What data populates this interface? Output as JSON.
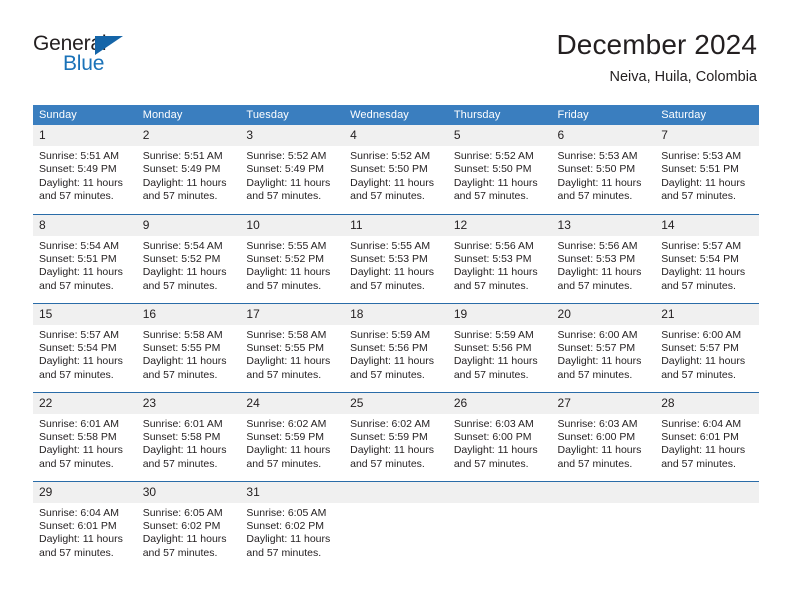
{
  "brand": {
    "name_top": "General",
    "name_bottom": "Blue",
    "accent_color": "#1a72b8",
    "triangle_color": "#1565a8"
  },
  "header": {
    "title": "December 2024",
    "subtitle": "Neiva, Huila, Colombia"
  },
  "theme": {
    "header_bg": "#3a7ebf",
    "daynum_bg": "#f0f0f0",
    "row_divider": "#2a6ca8",
    "text": "#231f20"
  },
  "weekday_headers": [
    "Sunday",
    "Monday",
    "Tuesday",
    "Wednesday",
    "Thursday",
    "Friday",
    "Saturday"
  ],
  "labels": {
    "sunrise_prefix": "Sunrise:",
    "sunset_prefix": "Sunset:",
    "daylight_prefix": "Daylight:"
  },
  "weeks": [
    [
      {
        "day": "1",
        "sunrise": "Sunrise: 5:51 AM",
        "sunset": "Sunset: 5:49 PM",
        "daylight": "Daylight: 11 hours and 57 minutes."
      },
      {
        "day": "2",
        "sunrise": "Sunrise: 5:51 AM",
        "sunset": "Sunset: 5:49 PM",
        "daylight": "Daylight: 11 hours and 57 minutes."
      },
      {
        "day": "3",
        "sunrise": "Sunrise: 5:52 AM",
        "sunset": "Sunset: 5:49 PM",
        "daylight": "Daylight: 11 hours and 57 minutes."
      },
      {
        "day": "4",
        "sunrise": "Sunrise: 5:52 AM",
        "sunset": "Sunset: 5:50 PM",
        "daylight": "Daylight: 11 hours and 57 minutes."
      },
      {
        "day": "5",
        "sunrise": "Sunrise: 5:52 AM",
        "sunset": "Sunset: 5:50 PM",
        "daylight": "Daylight: 11 hours and 57 minutes."
      },
      {
        "day": "6",
        "sunrise": "Sunrise: 5:53 AM",
        "sunset": "Sunset: 5:50 PM",
        "daylight": "Daylight: 11 hours and 57 minutes."
      },
      {
        "day": "7",
        "sunrise": "Sunrise: 5:53 AM",
        "sunset": "Sunset: 5:51 PM",
        "daylight": "Daylight: 11 hours and 57 minutes."
      }
    ],
    [
      {
        "day": "8",
        "sunrise": "Sunrise: 5:54 AM",
        "sunset": "Sunset: 5:51 PM",
        "daylight": "Daylight: 11 hours and 57 minutes."
      },
      {
        "day": "9",
        "sunrise": "Sunrise: 5:54 AM",
        "sunset": "Sunset: 5:52 PM",
        "daylight": "Daylight: 11 hours and 57 minutes."
      },
      {
        "day": "10",
        "sunrise": "Sunrise: 5:55 AM",
        "sunset": "Sunset: 5:52 PM",
        "daylight": "Daylight: 11 hours and 57 minutes."
      },
      {
        "day": "11",
        "sunrise": "Sunrise: 5:55 AM",
        "sunset": "Sunset: 5:53 PM",
        "daylight": "Daylight: 11 hours and 57 minutes."
      },
      {
        "day": "12",
        "sunrise": "Sunrise: 5:56 AM",
        "sunset": "Sunset: 5:53 PM",
        "daylight": "Daylight: 11 hours and 57 minutes."
      },
      {
        "day": "13",
        "sunrise": "Sunrise: 5:56 AM",
        "sunset": "Sunset: 5:53 PM",
        "daylight": "Daylight: 11 hours and 57 minutes."
      },
      {
        "day": "14",
        "sunrise": "Sunrise: 5:57 AM",
        "sunset": "Sunset: 5:54 PM",
        "daylight": "Daylight: 11 hours and 57 minutes."
      }
    ],
    [
      {
        "day": "15",
        "sunrise": "Sunrise: 5:57 AM",
        "sunset": "Sunset: 5:54 PM",
        "daylight": "Daylight: 11 hours and 57 minutes."
      },
      {
        "day": "16",
        "sunrise": "Sunrise: 5:58 AM",
        "sunset": "Sunset: 5:55 PM",
        "daylight": "Daylight: 11 hours and 57 minutes."
      },
      {
        "day": "17",
        "sunrise": "Sunrise: 5:58 AM",
        "sunset": "Sunset: 5:55 PM",
        "daylight": "Daylight: 11 hours and 57 minutes."
      },
      {
        "day": "18",
        "sunrise": "Sunrise: 5:59 AM",
        "sunset": "Sunset: 5:56 PM",
        "daylight": "Daylight: 11 hours and 57 minutes."
      },
      {
        "day": "19",
        "sunrise": "Sunrise: 5:59 AM",
        "sunset": "Sunset: 5:56 PM",
        "daylight": "Daylight: 11 hours and 57 minutes."
      },
      {
        "day": "20",
        "sunrise": "Sunrise: 6:00 AM",
        "sunset": "Sunset: 5:57 PM",
        "daylight": "Daylight: 11 hours and 57 minutes."
      },
      {
        "day": "21",
        "sunrise": "Sunrise: 6:00 AM",
        "sunset": "Sunset: 5:57 PM",
        "daylight": "Daylight: 11 hours and 57 minutes."
      }
    ],
    [
      {
        "day": "22",
        "sunrise": "Sunrise: 6:01 AM",
        "sunset": "Sunset: 5:58 PM",
        "daylight": "Daylight: 11 hours and 57 minutes."
      },
      {
        "day": "23",
        "sunrise": "Sunrise: 6:01 AM",
        "sunset": "Sunset: 5:58 PM",
        "daylight": "Daylight: 11 hours and 57 minutes."
      },
      {
        "day": "24",
        "sunrise": "Sunrise: 6:02 AM",
        "sunset": "Sunset: 5:59 PM",
        "daylight": "Daylight: 11 hours and 57 minutes."
      },
      {
        "day": "25",
        "sunrise": "Sunrise: 6:02 AM",
        "sunset": "Sunset: 5:59 PM",
        "daylight": "Daylight: 11 hours and 57 minutes."
      },
      {
        "day": "26",
        "sunrise": "Sunrise: 6:03 AM",
        "sunset": "Sunset: 6:00 PM",
        "daylight": "Daylight: 11 hours and 57 minutes."
      },
      {
        "day": "27",
        "sunrise": "Sunrise: 6:03 AM",
        "sunset": "Sunset: 6:00 PM",
        "daylight": "Daylight: 11 hours and 57 minutes."
      },
      {
        "day": "28",
        "sunrise": "Sunrise: 6:04 AM",
        "sunset": "Sunset: 6:01 PM",
        "daylight": "Daylight: 11 hours and 57 minutes."
      }
    ],
    [
      {
        "day": "29",
        "sunrise": "Sunrise: 6:04 AM",
        "sunset": "Sunset: 6:01 PM",
        "daylight": "Daylight: 11 hours and 57 minutes."
      },
      {
        "day": "30",
        "sunrise": "Sunrise: 6:05 AM",
        "sunset": "Sunset: 6:02 PM",
        "daylight": "Daylight: 11 hours and 57 minutes."
      },
      {
        "day": "31",
        "sunrise": "Sunrise: 6:05 AM",
        "sunset": "Sunset: 6:02 PM",
        "daylight": "Daylight: 11 hours and 57 minutes."
      },
      {
        "day": "",
        "sunrise": "",
        "sunset": "",
        "daylight": ""
      },
      {
        "day": "",
        "sunrise": "",
        "sunset": "",
        "daylight": ""
      },
      {
        "day": "",
        "sunrise": "",
        "sunset": "",
        "daylight": ""
      },
      {
        "day": "",
        "sunrise": "",
        "sunset": "",
        "daylight": ""
      }
    ]
  ]
}
